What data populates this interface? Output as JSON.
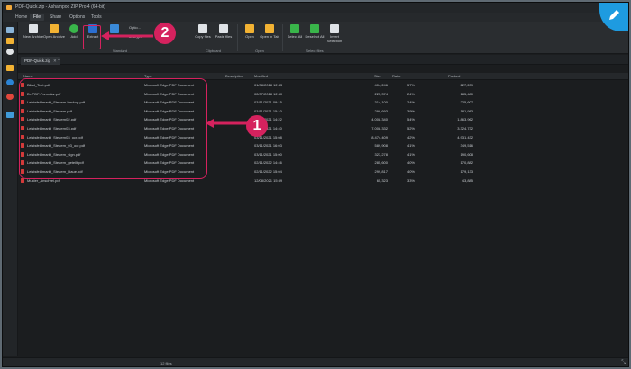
{
  "window": {
    "title": "PDF-Quick.zip - Ashampoo ZIP Pro 4 (64-bit)"
  },
  "menus": [
    "Home",
    "File",
    "Share",
    "Options",
    "Tools"
  ],
  "ribbon": {
    "new_archive": "New Archive",
    "open_archive": "Open Archive",
    "add": "Add",
    "extract": "Extract",
    "options": "Optio...",
    "encrypt": "Encrypt",
    "copy_files": "Copy files",
    "paste_files": "Paste files",
    "open": "Open",
    "open_in_tab": "Open in Tab",
    "select_all": "Select All",
    "deselect_all": "Deselect All",
    "invert_selection": "Invert Selection",
    "group_standard": "Standard",
    "group_clipboard": "Clipboard",
    "group_open": "Open",
    "group_select_files": "Select files"
  },
  "tab": {
    "label": "PDF-Quick.zip",
    "close": "✕",
    "add": "+"
  },
  "columns": {
    "name": "Name",
    "type": "Type",
    "description": "Description",
    "modified": "Modified",
    "size": "Size",
    "ratio": "Ratio",
    "packed": "Packed"
  },
  "files": [
    {
      "name": "Blind_Text.pdf",
      "type": "Microsoft Edge PDF Document",
      "modified": "01/08/2018 12:33",
      "size": "404,246",
      "ratio": "57%",
      "packed": "227,209"
    },
    {
      "name": "Dr-PDF-Formular.pdf",
      "type": "Microsoft Edge PDF Document",
      "modified": "02/07/2018 12:50",
      "size": "225,374",
      "ratio": "24%",
      "packed": "185,480"
    },
    {
      "name": "Leistsfeldmarkt_Steuern-backup.pdf",
      "type": "Microsoft Edge PDF Document",
      "modified": "03/11/2021 09:15",
      "size": "314,100",
      "ratio": "24%",
      "packed": "225,607"
    },
    {
      "name": "Leistsfeldmarkt_Steuern.pdf",
      "type": "Microsoft Edge PDF Document",
      "modified": "03/11/2021 15:10",
      "size": "298,693",
      "ratio": "39%",
      "packed": "181,983"
    },
    {
      "name": "Leistsfeldmarkt_Steuern02.pdf",
      "type": "Microsoft Edge PDF Document",
      "modified": "03/11/2021 14:22",
      "size": "4,008,340",
      "ratio": "54%",
      "packed": "1,863,962"
    },
    {
      "name": "Leistsfeldmarkt_Steuern03.pdf",
      "type": "Microsoft Edge PDF Document",
      "modified": "03/11/2021 14:40",
      "size": "7,008,332",
      "ratio": "52%",
      "packed": "3,324,732"
    },
    {
      "name": "Leistsfeldmarkt_Steuern03_ocr.pdf",
      "type": "Microsoft Edge PDF Document",
      "modified": "03/11/2021 15:08",
      "size": "8,474,409",
      "ratio": "42%",
      "packed": "4,931,432"
    },
    {
      "name": "Leistsfeldmarkt_Steuern_03_ocr.pdf",
      "type": "Microsoft Edge PDF Document",
      "modified": "03/11/2021 16:03",
      "size": "589,908",
      "ratio": "41%",
      "packed": "349,516"
    },
    {
      "name": "Leistsfeldmarkt_Steuern_sign.pdf",
      "type": "Microsoft Edge PDF Document",
      "modified": "03/11/2021 15:00",
      "size": "323,278",
      "ratio": "41%",
      "packed": "190,608"
    },
    {
      "name": "Leistsfeldmarkt_Steuern_geteilt.pdf",
      "type": "Microsoft Edge PDF Document",
      "modified": "02/11/2022 14:46",
      "size": "285,600",
      "ratio": "40%",
      "packed": "170,882"
    },
    {
      "name": "Leistsfeldmarkt_Steuern_klaue.pdf",
      "type": "Microsoft Edge PDF Document",
      "modified": "02/11/2022 15:04",
      "size": "299,817",
      "ratio": "40%",
      "packed": "179,133"
    },
    {
      "name": "Muster_Anschrei.pdf",
      "type": "Microsoft Edge PDF Document",
      "modified": "12/08/2021 15:59",
      "size": "65,323",
      "ratio": "33%",
      "packed": "43,885"
    }
  ],
  "status": {
    "text": "12 files"
  },
  "callouts": {
    "one": "1",
    "two": "2"
  },
  "colors": {
    "accent": "#1e9be0",
    "callout": "#d5225e",
    "background": "#1b1d1f"
  }
}
